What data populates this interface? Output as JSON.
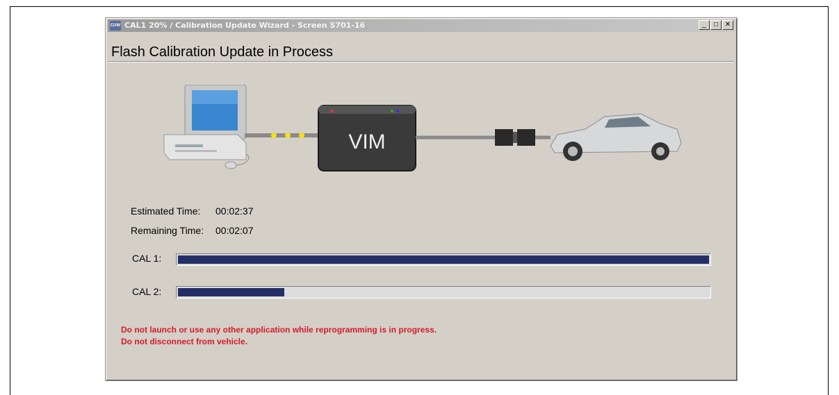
{
  "window": {
    "title": "CAL1 20% / Calibration Update Wizard - Screen S701-16",
    "controls": [
      "minimize",
      "maximize",
      "close"
    ]
  },
  "page": {
    "heading": "Flash Calibration Update in Process"
  },
  "diagram": {
    "device_label": "VIM",
    "items": [
      "computer",
      "VIM",
      "connector",
      "vehicle"
    ]
  },
  "timing": {
    "estimated_label": "Estimated Time:",
    "estimated_value": "00:02:37",
    "remaining_label": "Remaining Time:",
    "remaining_value": "00:02:07"
  },
  "progress": [
    {
      "label": "CAL 1:",
      "fraction": 1.0
    },
    {
      "label": "CAL 2:",
      "fraction": 0.2
    }
  ],
  "warnings": [
    "Do not launch or use any other application while reprogramming is in progress.",
    "Do not disconnect from vehicle."
  ],
  "colors": {
    "progress": "#232f66",
    "warning": "#d61a2a",
    "window_bg": "#d4d0c8"
  }
}
